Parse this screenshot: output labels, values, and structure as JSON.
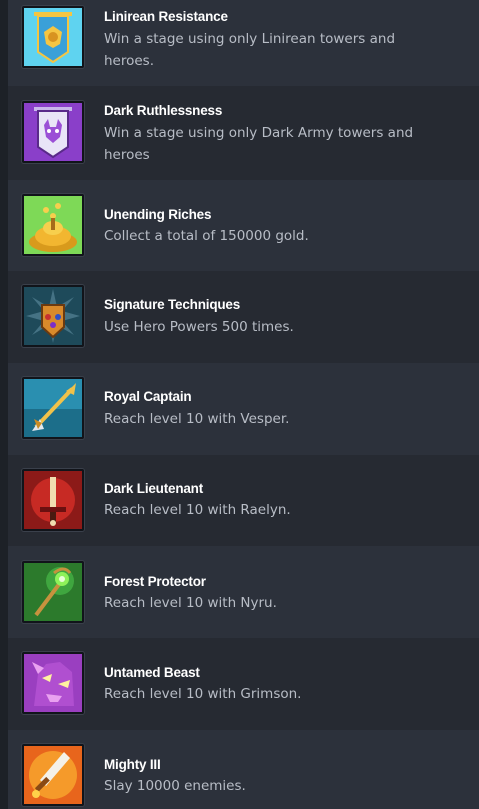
{
  "achievements": [
    {
      "title": "Linirean Resistance",
      "description": "Win a stage using only Linirean towers and heroes.",
      "icon": "linirean-banner-icon",
      "colors": [
        "#5fd3f0",
        "#f5c542"
      ]
    },
    {
      "title": "Dark Ruthlessness",
      "description": "Win a stage using only Dark Army towers and heroes",
      "icon": "dark-army-banner-icon",
      "colors": [
        "#9b4fd6",
        "#e9e4f7"
      ]
    },
    {
      "title": "Unending Riches",
      "description": "Collect a total of 150000 gold.",
      "icon": "gold-pile-icon",
      "colors": [
        "#7ed957",
        "#f2b630"
      ]
    },
    {
      "title": "Signature Techniques",
      "description": "Use Hero Powers 500 times.",
      "icon": "power-gauntlet-icon",
      "colors": [
        "#2f6f80",
        "#d98a2b"
      ]
    },
    {
      "title": "Royal Captain",
      "description": "Reach level 10 with Vesper.",
      "icon": "golden-arrow-icon",
      "colors": [
        "#2fa7c4",
        "#f0c24a"
      ]
    },
    {
      "title": "Dark Lieutenant",
      "description": "Reach level 10 with Raelyn.",
      "icon": "dark-sword-icon",
      "colors": [
        "#b3211e",
        "#f0ddb0"
      ]
    },
    {
      "title": "Forest Protector",
      "description": "Reach level 10 with Nyru.",
      "icon": "forest-staff-icon",
      "colors": [
        "#2c7a2c",
        "#8ef25a"
      ]
    },
    {
      "title": "Untamed Beast",
      "description": "Reach level 10 with Grimson.",
      "icon": "beast-portrait-icon",
      "colors": [
        "#b04fd0",
        "#e9a1f0"
      ]
    },
    {
      "title": "Mighty III",
      "description": "Slay 10000 enemies.",
      "icon": "flaming-sword-icon",
      "colors": [
        "#e8651c",
        "#ffd24a"
      ]
    }
  ]
}
